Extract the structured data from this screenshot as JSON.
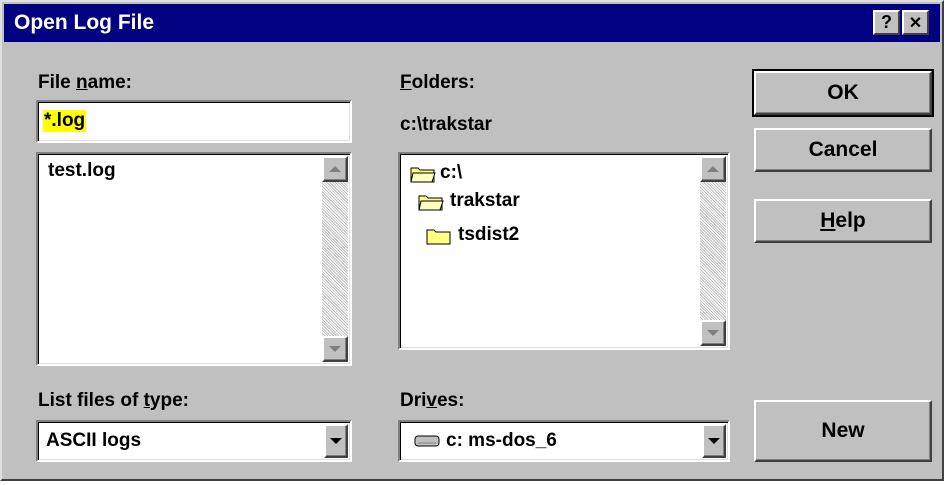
{
  "window": {
    "title": "Open Log File"
  },
  "titlebar_buttons": {
    "help": "?",
    "close": "✕"
  },
  "file_name": {
    "label_pre": "File ",
    "label_u": "n",
    "label_post": "ame:",
    "value": "*.log"
  },
  "files": {
    "items": [
      "test.log"
    ]
  },
  "folders": {
    "label_u": "F",
    "label_post": "olders:",
    "current_path": "c:\\trakstar",
    "items": [
      "c:\\",
      "trakstar",
      "tsdist2"
    ]
  },
  "buttons": {
    "ok": "OK",
    "cancel": "Cancel",
    "help_u": "H",
    "help_post": "elp",
    "new": "New"
  },
  "file_type": {
    "label_pre": "List files of ",
    "label_u": "t",
    "label_post": "ype:",
    "selected": "ASCII logs"
  },
  "drives": {
    "label_pre": "Dri",
    "label_u": "v",
    "label_post": "es:",
    "selected": "c: ms-dos_6"
  }
}
